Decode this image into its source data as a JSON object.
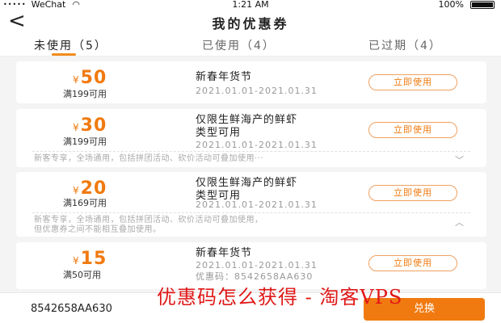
{
  "status_bar": {
    "signal": "•••••",
    "carrier": "WeChat",
    "wifi": "◠",
    "time": "1:21 AM",
    "battery": "100%"
  },
  "header": {
    "back": "<",
    "title": "我的优惠券"
  },
  "tabs": [
    {
      "label": "未使用（5）",
      "active": true
    },
    {
      "label": "已使用（4）",
      "active": false
    },
    {
      "label": "已过期（4）",
      "active": false
    }
  ],
  "coupons": [
    {
      "currency": "¥",
      "amount": "50",
      "condition": "满199可用",
      "title": "新春年货节",
      "date": "2021.01.01-2021.01.31",
      "button": "立即使用"
    },
    {
      "currency": "¥",
      "amount": "30",
      "condition": "满199可用",
      "title_line1": "仅限生鲜海产的鲜虾",
      "title_line2": "类型可用",
      "date": "2021.01.01-2021.01.31",
      "button": "立即使用",
      "description": "新客专享，全场通用，包括拼团活动、砍价活动可叠加使用···",
      "toggle": "﹀"
    },
    {
      "currency": "¥",
      "amount": "20",
      "condition": "满169可用",
      "title_line1": "仅限生鲜海产的鲜虾",
      "title_line2": "类型可用",
      "date": "2021.01.01-2021.01.31",
      "button": "立即使用",
      "description_line1": "新客专享，全场通用，包括拼团活动、砍价活动可叠加使用，",
      "description_line2": "但优惠券之间不能相互叠加使用。",
      "toggle": "︿"
    },
    {
      "currency": "¥",
      "amount": "15",
      "condition": "满50可用",
      "title": "新春年货节",
      "date": "2021.01.01-2021.01.31",
      "code": "优惠码：8542658AA630",
      "button": "立即使用"
    }
  ],
  "bottom_bar": {
    "code_value": "8542658AA630",
    "exchange_button": "兑换"
  },
  "watermark": "优惠码怎么获得 - 淘客VPS",
  "colors": {
    "accent": "#f07a10",
    "watermark": "#e01818"
  }
}
